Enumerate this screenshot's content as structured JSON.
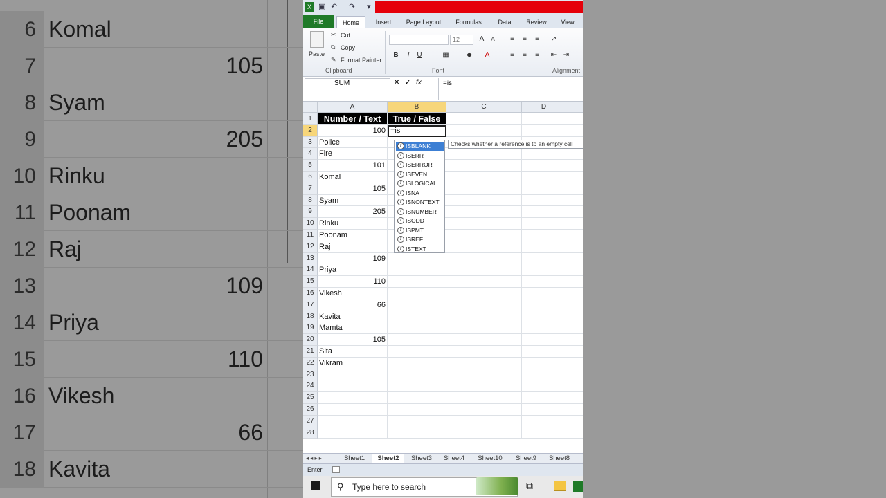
{
  "background": {
    "rows": [
      {
        "num": "6",
        "text": "Komal",
        "value": ""
      },
      {
        "num": "7",
        "text": "",
        "value": "105"
      },
      {
        "num": "8",
        "text": "Syam",
        "value": ""
      },
      {
        "num": "9",
        "text": "",
        "value": "205"
      },
      {
        "num": "10",
        "text": "Rinku",
        "value": ""
      },
      {
        "num": "11",
        "text": "Poonam",
        "value": ""
      },
      {
        "num": "12",
        "text": "Raj",
        "value": ""
      },
      {
        "num": "13",
        "text": "",
        "value": "109"
      },
      {
        "num": "14",
        "text": "Priya",
        "value": ""
      },
      {
        "num": "15",
        "text": "",
        "value": "110"
      },
      {
        "num": "16",
        "text": "Vikesh",
        "value": ""
      },
      {
        "num": "17",
        "text": "",
        "value": "66"
      },
      {
        "num": "18",
        "text": "Kavita",
        "value": ""
      }
    ]
  },
  "ribbon": {
    "tabs": [
      "File",
      "Home",
      "Insert",
      "Page Layout",
      "Formulas",
      "Data",
      "Review",
      "View"
    ],
    "clipboard": {
      "paste": "Paste",
      "cut": "Cut",
      "copy": "Copy",
      "format_painter": "Format Painter",
      "label": "Clipboard"
    },
    "font": {
      "size": "12",
      "label": "Font"
    },
    "alignment": {
      "label": "Alignment"
    }
  },
  "formula_bar": {
    "name_box": "SUM",
    "formula": "=is"
  },
  "grid": {
    "columns": [
      "A",
      "B",
      "C",
      "D"
    ],
    "rows": [
      {
        "num": "1",
        "a": "Number / Text",
        "b": "True / False",
        "a_num": false
      },
      {
        "num": "2",
        "a": "100",
        "b": "=is",
        "a_num": true
      },
      {
        "num": "3",
        "a": "Police",
        "b": "",
        "a_num": false
      },
      {
        "num": "4",
        "a": "Fire",
        "b": "",
        "a_num": false
      },
      {
        "num": "5",
        "a": "101",
        "b": "",
        "a_num": true
      },
      {
        "num": "6",
        "a": "Komal",
        "b": "",
        "a_num": false
      },
      {
        "num": "7",
        "a": "105",
        "b": "",
        "a_num": true
      },
      {
        "num": "8",
        "a": "Syam",
        "b": "",
        "a_num": false
      },
      {
        "num": "9",
        "a": "205",
        "b": "",
        "a_num": true
      },
      {
        "num": "10",
        "a": "Rinku",
        "b": "",
        "a_num": false
      },
      {
        "num": "11",
        "a": "Poonam",
        "b": "",
        "a_num": false
      },
      {
        "num": "12",
        "a": "Raj",
        "b": "",
        "a_num": false
      },
      {
        "num": "13",
        "a": "109",
        "b": "",
        "a_num": true
      },
      {
        "num": "14",
        "a": "Priya",
        "b": "",
        "a_num": false
      },
      {
        "num": "15",
        "a": "110",
        "b": "",
        "a_num": true
      },
      {
        "num": "16",
        "a": "Vikesh",
        "b": "",
        "a_num": false
      },
      {
        "num": "17",
        "a": "66",
        "b": "",
        "a_num": true
      },
      {
        "num": "18",
        "a": "Kavita",
        "b": "",
        "a_num": false
      },
      {
        "num": "19",
        "a": "Mamta",
        "b": "",
        "a_num": false
      },
      {
        "num": "20",
        "a": "105",
        "b": "",
        "a_num": true
      },
      {
        "num": "21",
        "a": "Sita",
        "b": "",
        "a_num": false
      },
      {
        "num": "22",
        "a": "Vikram",
        "b": "",
        "a_num": false
      },
      {
        "num": "23",
        "a": "",
        "b": "",
        "a_num": false
      },
      {
        "num": "24",
        "a": "",
        "b": "",
        "a_num": false
      },
      {
        "num": "25",
        "a": "",
        "b": "",
        "a_num": false
      },
      {
        "num": "26",
        "a": "",
        "b": "",
        "a_num": false
      },
      {
        "num": "27",
        "a": "",
        "b": "",
        "a_num": false
      },
      {
        "num": "28",
        "a": "",
        "b": "",
        "a_num": false
      }
    ]
  },
  "autocomplete": {
    "items": [
      "ISBLANK",
      "ISERR",
      "ISERROR",
      "ISEVEN",
      "ISLOGICAL",
      "ISNA",
      "ISNONTEXT",
      "ISNUMBER",
      "ISODD",
      "ISPMT",
      "ISREF",
      "ISTEXT"
    ],
    "selected": 0,
    "tooltip": "Checks whether a reference is to an empty cell"
  },
  "sheet_tabs": [
    "Sheet1",
    "Sheet2",
    "Sheet3",
    "Sheet4",
    "Sheet10",
    "Sheet9",
    "Sheet8"
  ],
  "active_sheet": "Sheet2",
  "status": {
    "mode": "Enter"
  },
  "taskbar": {
    "search_placeholder": "Type here to search"
  },
  "colors": {
    "accent_file": "#1f7a28",
    "title_red": "#e5000a",
    "selection": "#3c7fd4",
    "header_highlight": "#f7d67a"
  }
}
